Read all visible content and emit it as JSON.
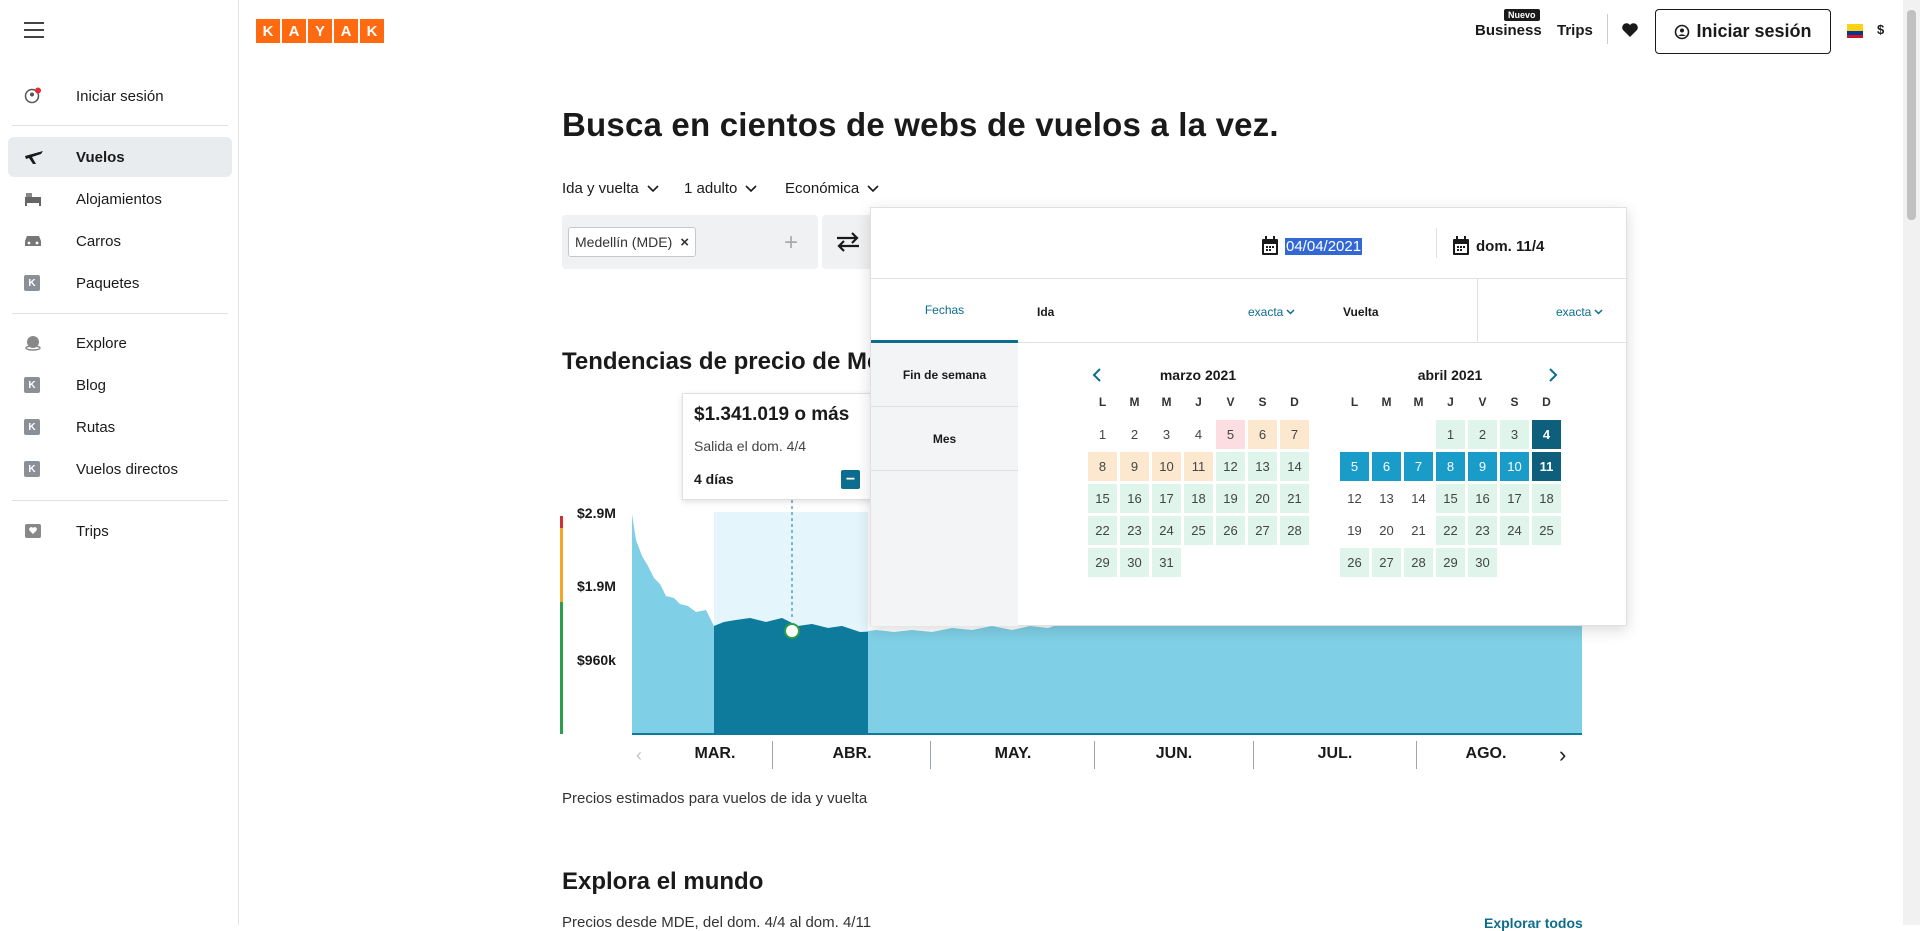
{
  "brand": {
    "logo_letters": [
      "K",
      "A",
      "Y",
      "A",
      "K"
    ],
    "color": "#ff690f"
  },
  "sidebar": {
    "items": [
      {
        "label": "Iniciar sesión",
        "icon": "user-circle-icon"
      },
      {
        "label": "Vuelos",
        "icon": "plane-icon",
        "active": true
      },
      {
        "label": "Alojamientos",
        "icon": "bed-icon"
      },
      {
        "label": "Carros",
        "icon": "car-icon"
      },
      {
        "label": "Paquetes",
        "icon": "kayak-k-icon"
      },
      {
        "label": "Explore",
        "icon": "globe-icon"
      },
      {
        "label": "Blog",
        "icon": "kayak-k-icon"
      },
      {
        "label": "Rutas",
        "icon": "kayak-k-icon"
      },
      {
        "label": "Vuelos directos",
        "icon": "kayak-k-icon"
      },
      {
        "label": "Trips",
        "icon": "trips-icon"
      }
    ]
  },
  "header": {
    "business": "Business",
    "nuevo": "Nuevo",
    "trips": "Trips",
    "signin": "Iniciar sesión",
    "currency": "$"
  },
  "search": {
    "title": "Busca en cientos de webs de vuelos a la vez.",
    "trip_type": "Ida y vuelta",
    "passengers": "1 adulto",
    "cabin": "Económica",
    "origin_chip": "Medellín (MDE)"
  },
  "trends": {
    "title": "Tendencias de precio de Me",
    "tooltip": {
      "price": "$1.341.019 o más",
      "departure": "Salida el dom. 4/4",
      "duration": "4 días"
    },
    "note": "Precios estimados para vuelos de ida y vuelta"
  },
  "chart_data": {
    "type": "area",
    "y_ticks": [
      "$2.9M",
      "$1.9M",
      "$960k"
    ],
    "x_labels": [
      "MAR.",
      "ABR.",
      "MAY.",
      "JUN.",
      "JUL.",
      "AGO."
    ],
    "colors": {
      "area": "#7fd0e6",
      "selected": "#0e7a9c"
    }
  },
  "explore": {
    "title": "Explora el mundo",
    "subtitle": "Precios desde MDE, del dom. 4/4 al dom. 4/11",
    "link": "Explorar todos"
  },
  "datepicker": {
    "depart_value": "04/04/2021",
    "return_value": "dom. 11/4",
    "tabs": [
      "Fechas",
      "Fin de semana",
      "Mes"
    ],
    "leg_depart": "Ida",
    "leg_return": "Vuelta",
    "exact": "exacta",
    "weekdays": [
      "L",
      "M",
      "M",
      "J",
      "V",
      "S",
      "D"
    ],
    "months": [
      {
        "title": "marzo 2021"
      },
      {
        "title": "abril 2021"
      }
    ]
  }
}
